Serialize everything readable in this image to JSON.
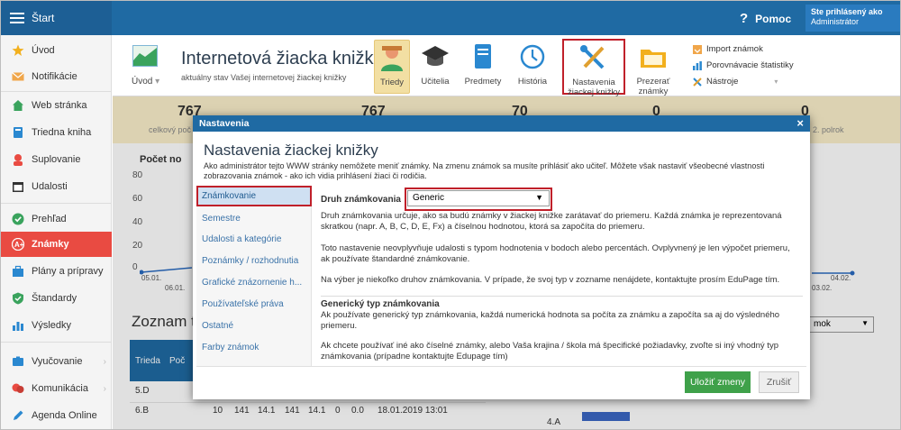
{
  "topbar": {
    "title": "Štart",
    "help": "Pomoc",
    "user_line1": "Ste prihlásený ako",
    "user_line2": "Administrátor"
  },
  "sidebar": {
    "items": [
      {
        "label": "Úvod",
        "icon": "star-icon",
        "color": "#f2b01e"
      },
      {
        "label": "Notifikácie",
        "icon": "mail-icon",
        "color": "#f0a64a"
      },
      {
        "label": "Web stránka",
        "icon": "home-icon",
        "color": "#3aa35d"
      },
      {
        "label": "Triedna kniha",
        "icon": "book-icon",
        "color": "#2a88d0"
      },
      {
        "label": "Suplovanie",
        "icon": "person-icon",
        "color": "#e94b42"
      },
      {
        "label": "Udalosti",
        "icon": "calendar-icon",
        "color": "#333333"
      },
      {
        "label": "Prehľad",
        "icon": "check-circle-icon",
        "color": "#3aa35d"
      },
      {
        "label": "Známky",
        "icon": "grade-icon",
        "color": "#ffffff"
      },
      {
        "label": "Plány a prípravy",
        "icon": "briefcase-icon",
        "color": "#2a88d0"
      },
      {
        "label": "Štandardy",
        "icon": "shield-check-icon",
        "color": "#3aa35d"
      },
      {
        "label": "Výsledky",
        "icon": "bar-chart-icon",
        "color": "#2a88d0"
      },
      {
        "label": "Vyučovanie",
        "icon": "hat-icon",
        "color": "#2a88d0"
      },
      {
        "label": "Komunikácia",
        "icon": "chat-icon",
        "color": "#e94b42"
      },
      {
        "label": "Agenda Online",
        "icon": "pen-icon",
        "color": "#2a88d0"
      }
    ]
  },
  "ribbon": {
    "uvod": "Úvod",
    "title": "Internetová žiacka knižka",
    "subtitle": "aktuálny stav Vašej internetovej žiackej knižky",
    "buttons": [
      {
        "label": "Triedy"
      },
      {
        "label": "Učitelia"
      },
      {
        "label": "Predmety"
      },
      {
        "label": "História"
      },
      {
        "label1": "Nastavenia",
        "label2": "žiackej knižky"
      },
      {
        "label1": "Prezerať",
        "label2": "známky"
      }
    ],
    "links": [
      "Import známok",
      "Porovnávacie štatistiky",
      "Nástroje"
    ]
  },
  "stats": {
    "items": [
      {
        "value": "767",
        "label": "celkový poč"
      },
      {
        "value": "767",
        "label": ""
      },
      {
        "value": "70",
        "label": ""
      },
      {
        "value": "0",
        "label": ""
      },
      {
        "value": "0",
        "label": "2. polrok"
      }
    ]
  },
  "chart": {
    "title": "Počet no",
    "yticks": [
      "80",
      "60",
      "40",
      "20",
      "0"
    ],
    "xlabels_left": [
      "05.01.",
      "06.01.",
      "0"
    ],
    "xlabels_right": [
      "04.02.",
      "03.02."
    ]
  },
  "list": {
    "title": "Zoznam tri",
    "head_trieda": "Trieda",
    "head_poc": "Poč",
    "select_value": "mok",
    "rows": [
      {
        "trieda": "5.D",
        "cells": []
      },
      {
        "trieda": "6.B",
        "cells": [
          "10",
          "141",
          "14.1",
          "141",
          "14.1",
          "0",
          "0.0",
          "18.01.2019 13:01"
        ]
      }
    ],
    "chart_row_label": "4.A"
  },
  "modal": {
    "header": "Nastavenia",
    "close": "×",
    "title": "Nastavenia žiackej knižky",
    "desc": "Ako administrátor tejto WWW stránky nemôžete meniť známky. Na zmenu známok sa musíte prihlásiť ako učiteľ. Môžete však nastaviť všeobecné vlastnosti zobrazovania známok - ako ich vidia prihlásení žiaci či rodičia.",
    "nav": [
      "Známkovanie",
      "Semestre",
      "Udalosti a kategórie",
      "Poznámky / rozhodnutia",
      "Grafické znázornenie h...",
      "Používateľské práva",
      "Ostatné",
      "Farby známok"
    ],
    "druh_label": "Druh známkovania",
    "druh_value": "Generic",
    "p1": "Druh známkovania určuje, ako sa budú známky v žiackej knižke zarátavať do priemeru. Každá známka je reprezentovaná skratkou (napr. A, B, C, D, E, Fx) a číselnou hodnotou, ktorá sa započíta do priemeru.",
    "p2": "Toto nastavenie neovplyvňuje udalosti s typom hodnotenia v bodoch alebo percentách. Ovplyvnený je len výpočet priemeru, ak používate štandardné známkovanie.",
    "p3": "Na výber je niekoľko druhov známkovania. V prípade, že svoj typ v zozname nenájdete, kontaktujte prosím EduPage tím.",
    "generic_title": "Generický typ známkovania",
    "p4": "Ak používate generický typ známkovania, každá numerická hodnota sa počíta za známku a započíta sa aj do výsledného priemeru.",
    "p5": "Ak chcete používať iné ako číselné známky, alebo Vaša krajina / škola má špecifické požiadavky, zvoľte si iný vhodný typ známkovania (prípadne kontaktujte Edupage tím)",
    "save": "Uložiť zmeny",
    "cancel": "Zrušiť"
  },
  "colors": {
    "topbar": "#1f6aa3",
    "active_item": "#e94b42",
    "highlight_box": "#c0202a",
    "save_button": "#3fa14a"
  }
}
